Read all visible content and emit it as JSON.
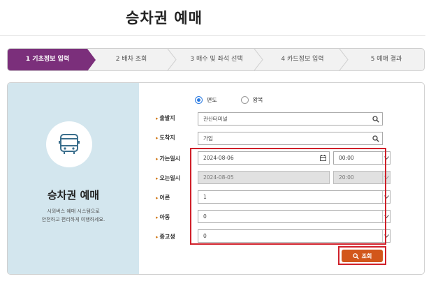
{
  "page": {
    "title": "승차권 예매"
  },
  "steps": [
    {
      "label": "1 기초정보 입력",
      "active": true
    },
    {
      "label": "2 배차 조회",
      "active": false
    },
    {
      "label": "3 매수 및 좌석 선택",
      "active": false
    },
    {
      "label": "4 카드정보 입력",
      "active": false
    },
    {
      "label": "5 예매 결과",
      "active": false
    }
  ],
  "panel": {
    "title": "승차권 예매",
    "desc_line1": "시외버스 예매 시스템으로",
    "desc_line2": "안전하고 편리하게 여행하세요."
  },
  "trip_type": {
    "options": [
      {
        "label": "편도",
        "selected": true
      },
      {
        "label": "왕복",
        "selected": false
      }
    ]
  },
  "form": {
    "departure": {
      "label": "출발지",
      "value": "관산터미널"
    },
    "arrival": {
      "label": "도착지",
      "value": "가업"
    },
    "go_date": {
      "label": "가는일시",
      "date": "2024-08-06",
      "time": "00:00"
    },
    "return_date": {
      "label": "오는일시",
      "date": "2024-08-05",
      "time": "20:00"
    },
    "adult": {
      "label": "어른",
      "value": "1"
    },
    "child": {
      "label": "아동",
      "value": "0"
    },
    "youth": {
      "label": "중고생",
      "value": "0"
    }
  },
  "actions": {
    "search_label": "조회"
  },
  "colors": {
    "accent": "#7b2f7b",
    "button": "#d2561b",
    "highlight": "#d0202a",
    "panel_bg": "#d3e6ee"
  }
}
